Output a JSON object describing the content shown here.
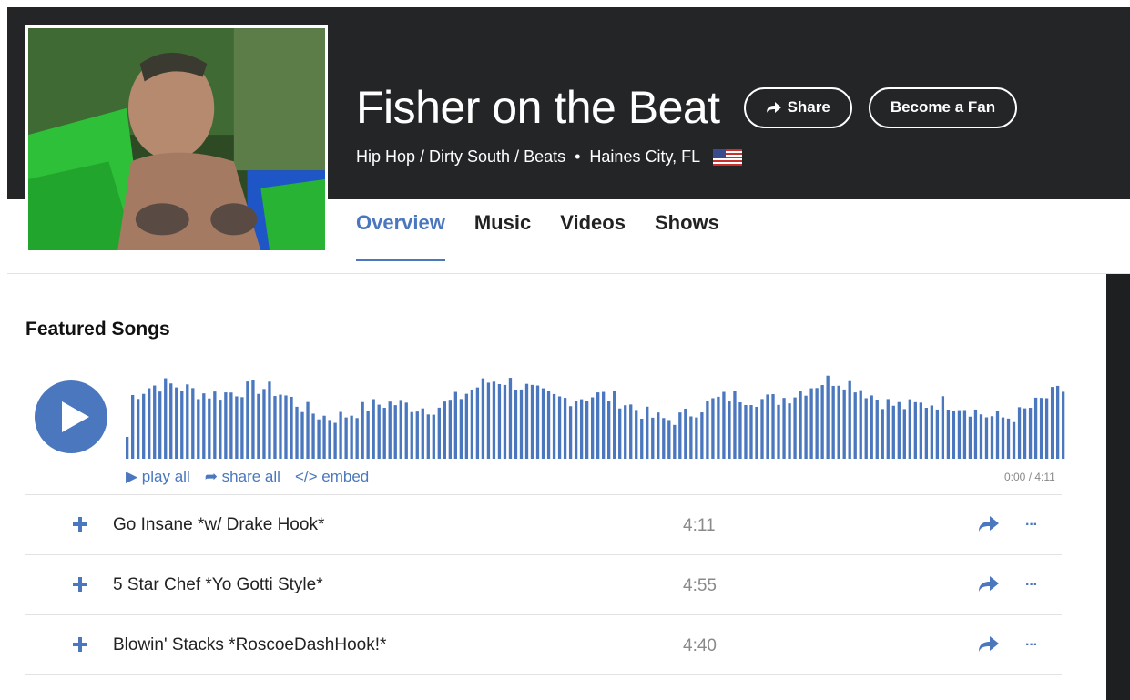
{
  "artist": {
    "name": "Fisher on the Beat",
    "genres": "Hip Hop / Dirty South / Beats",
    "separator": "•",
    "location": "Haines City, FL"
  },
  "actions": {
    "share_label": "Share",
    "fan_label": "Become a Fan"
  },
  "tabs": [
    {
      "label": "Overview",
      "active": true
    },
    {
      "label": "Music",
      "active": false
    },
    {
      "label": "Videos",
      "active": false
    },
    {
      "label": "Shows",
      "active": false
    }
  ],
  "featured": {
    "title": "Featured Songs",
    "play_all": "▶ play all",
    "share_all": "➦ share all",
    "embed": "</> embed",
    "time": "0:00 / 4:11"
  },
  "songs": [
    {
      "title": "Go Insane *w/ Drake Hook*",
      "duration": "4:11"
    },
    {
      "title": "5 Star Chef *Yo Gotti Style*",
      "duration": "4:55"
    },
    {
      "title": "Blowin' Stacks *RoscoeDashHook!*",
      "duration": "4:40"
    }
  ],
  "more_label": "···",
  "colors": {
    "accent": "#4a77be",
    "header_bg": "#232527"
  }
}
